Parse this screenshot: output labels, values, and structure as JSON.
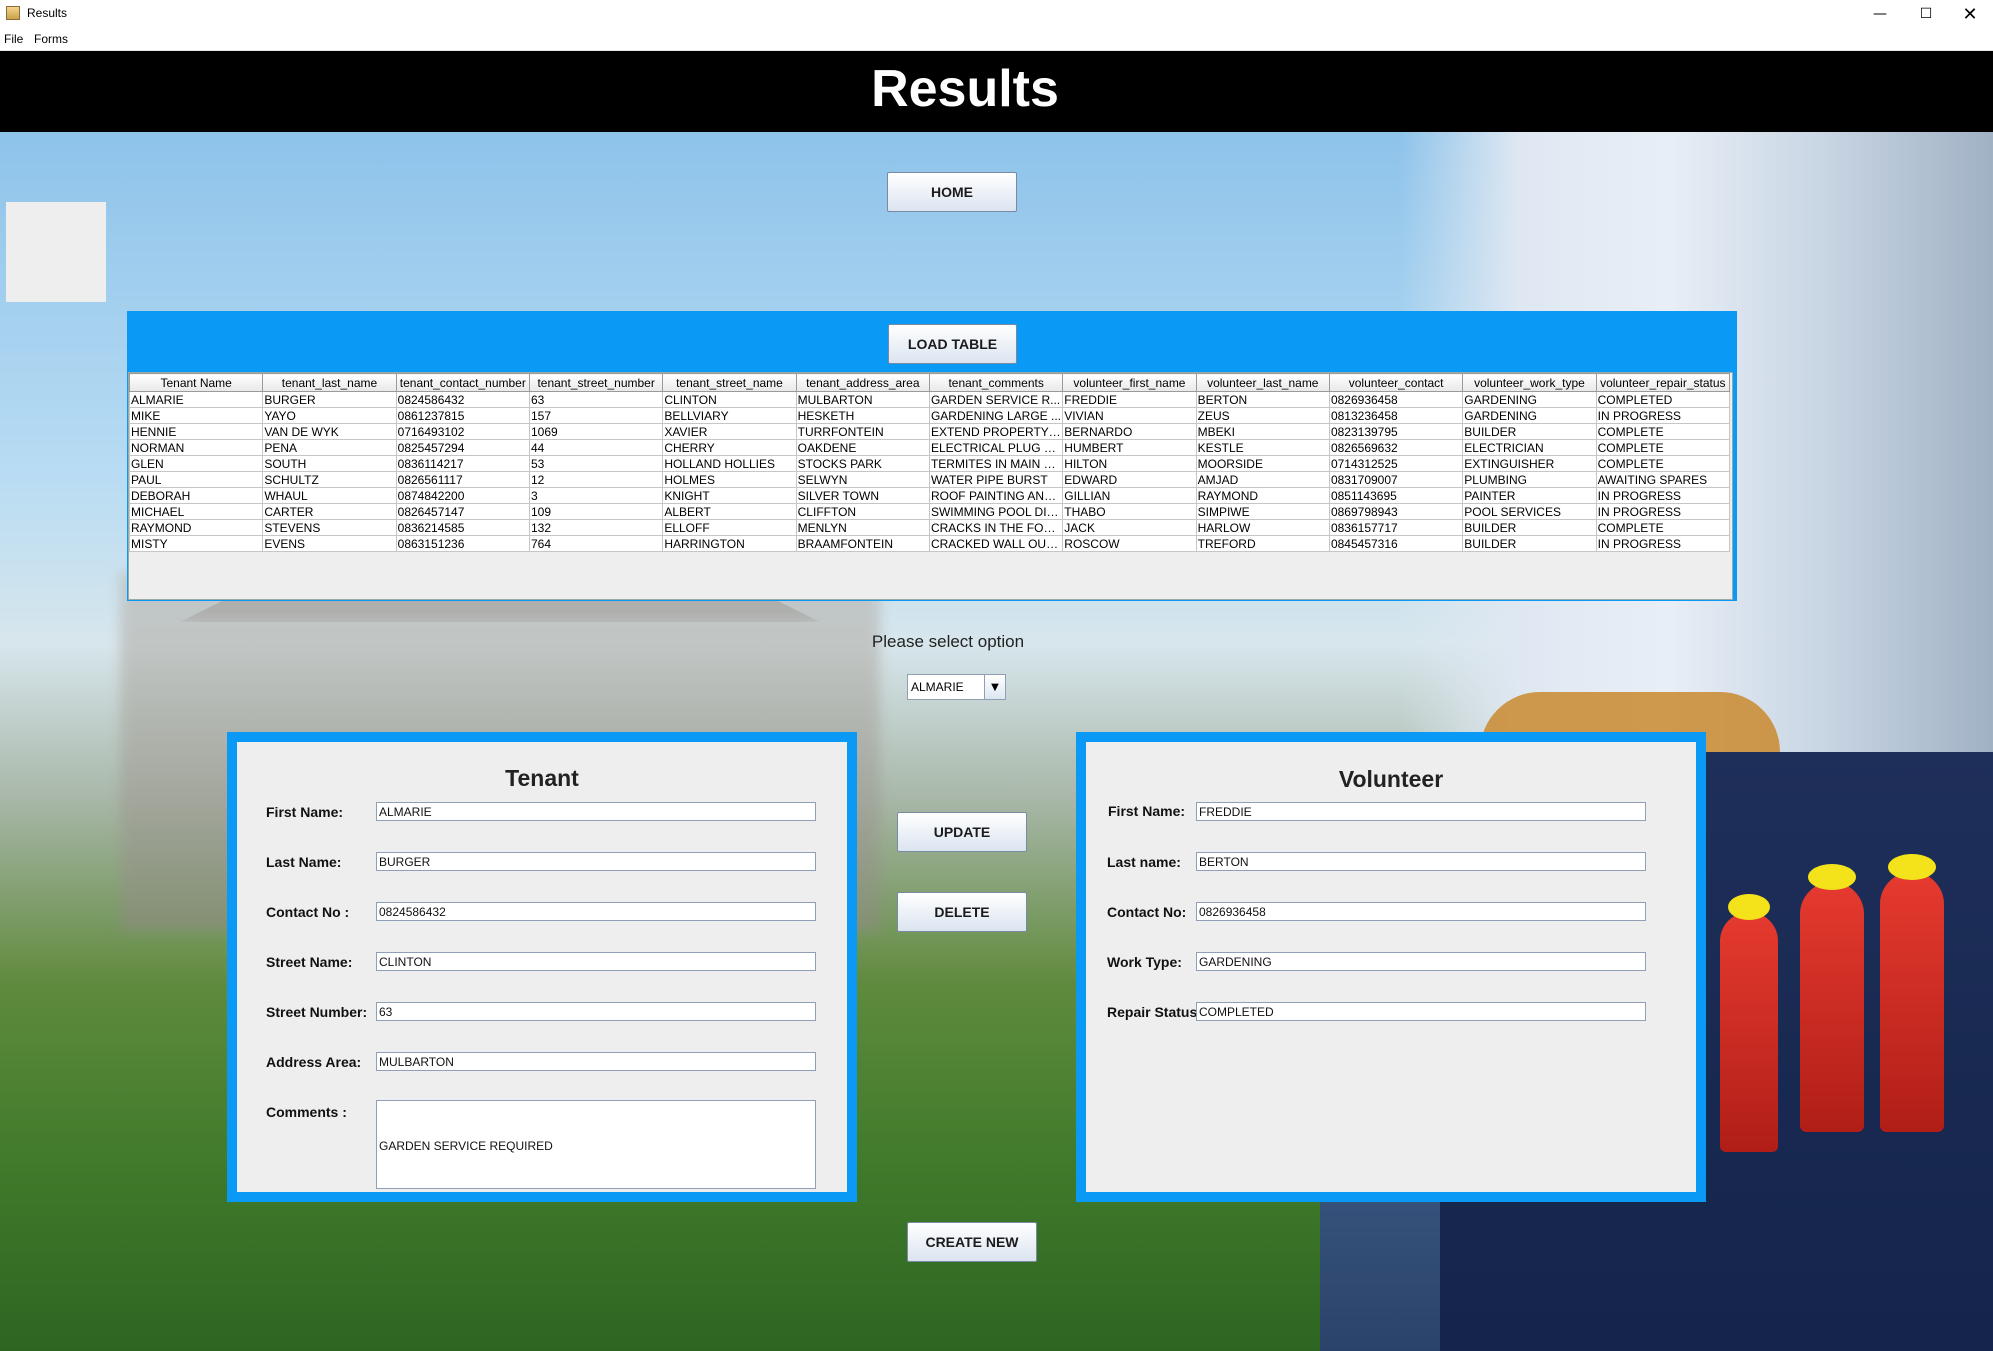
{
  "window": {
    "title": "Results",
    "minimize_icon": "minimize-icon",
    "maximize_icon": "maximize-icon",
    "close_icon": "close-icon"
  },
  "menu": {
    "file": "File",
    "forms": "Forms"
  },
  "header": {
    "title": "Results"
  },
  "buttons": {
    "home": "HOME",
    "load_table": "LOAD TABLE",
    "update": "UPDATE",
    "delete": "DELETE",
    "create_new": "CREATE NEW"
  },
  "table": {
    "columns": [
      "Tenant Name",
      "tenant_last_name",
      "tenant_contact_number",
      "tenant_street_number",
      "tenant_street_name",
      "tenant_address_area",
      "tenant_comments",
      "volunteer_first_name",
      "volunteer_last_name",
      "volunteer_contact",
      "volunteer_work_type",
      "volunteer_repair_status"
    ],
    "rows": [
      [
        "ALMARIE",
        "BURGER",
        "0824586432",
        "63",
        "CLINTON",
        "MULBARTON",
        "GARDEN SERVICE R...",
        "FREDDIE",
        "BERTON",
        "0826936458",
        "GARDENING",
        "COMPLETED"
      ],
      [
        "MIKE",
        "YAYO",
        "0861237815",
        "157",
        "BELLVIARY",
        "HESKETH",
        "GARDENING LARGE ...",
        "VIVIAN",
        "ZEUS",
        "0813236458",
        "GARDENING",
        "IN PROGRESS"
      ],
      [
        "HENNIE",
        "VAN DE WYK",
        "0716493102",
        "1069",
        "XAVIER",
        "TURRFONTEIN",
        "EXTEND PROPERTY ...",
        "BERNARDO",
        "MBEKI",
        "0823139795",
        "BUILDER",
        "COMPLETE"
      ],
      [
        "NORMAN",
        "PENA",
        "0825457294",
        "44",
        "CHERRY",
        "OAKDENE",
        "ELECTRICAL PLUG M...",
        "HUMBERT",
        "KESTLE",
        "0826569632",
        "ELECTRICIAN",
        "COMPLETE"
      ],
      [
        "GLEN",
        "SOUTH",
        "0836114217",
        "53",
        "HOLLAND HOLLIES",
        "STOCKS PARK",
        "TERMITES IN MAIN R...",
        "HILTON",
        "MOORSIDE",
        "0714312525",
        "EXTINGUISHER",
        "COMPLETE"
      ],
      [
        "PAUL",
        "SCHULTZ",
        "0826561117",
        "12",
        "HOLMES",
        "SELWYN",
        "WATER PIPE BURST",
        "EDWARD",
        "AMJAD",
        "0831709007",
        "PLUMBING",
        "AWAITING SPARES"
      ],
      [
        "DEBORAH",
        "WHAUL",
        "0874842200",
        "3",
        "KNIGHT",
        "SILVER TOWN",
        "ROOF PAINTING AND...",
        "GILLIAN",
        "RAYMOND",
        "0851143695",
        "PAINTER",
        "IN PROGRESS"
      ],
      [
        "MICHAEL",
        "CARTER",
        "0826457147",
        "109",
        "ALBERT",
        "CLIFFTON",
        "SWIMMING POOL DIR...",
        "THABO",
        "SIMPIWE",
        "0869798943",
        "POOL SERVICES",
        "IN PROGRESS"
      ],
      [
        "RAYMOND",
        "STEVENS",
        "0836214585",
        "132",
        "ELLOFF",
        "MENLYN",
        "CRACKS IN THE FOU...",
        "JACK",
        "HARLOW",
        "0836157717",
        "BUILDER",
        "COMPLETE"
      ],
      [
        "MISTY",
        "EVENS",
        "0863151236",
        "764",
        "HARRINGTON",
        "BRAAMFONTEIN",
        "CRACKED WALL OUT...",
        "ROSCOW",
        "TREFORD",
        "0845457316",
        "BUILDER",
        "IN PROGRESS"
      ]
    ]
  },
  "selector": {
    "label": "Please select option",
    "value": "ALMARIE"
  },
  "tenant": {
    "heading": "Tenant",
    "labels": {
      "first_name": "First Name:",
      "last_name": "Last Name:",
      "contact": "Contact No :",
      "street_name": "Street Name:",
      "street_number": "Street Number:",
      "address_area": "Address Area:",
      "comments": "Comments :"
    },
    "values": {
      "first_name": "ALMARIE",
      "last_name": "BURGER",
      "contact": "0824586432",
      "street_name": "CLINTON",
      "street_number": "63",
      "address_area": "MULBARTON",
      "comments": "GARDEN SERVICE REQUIRED"
    }
  },
  "volunteer": {
    "heading": "Volunteer",
    "labels": {
      "first_name": "First Name:",
      "last_name": "Last name:",
      "contact": "Contact No:",
      "work_type": "Work Type:",
      "repair_status": "Repair Status:"
    },
    "values": {
      "first_name": "FREDDIE",
      "last_name": "BERTON",
      "contact": "0826936458",
      "work_type": "GARDENING",
      "repair_status": "COMPLETED"
    }
  },
  "colors": {
    "accent_blue": "#0a9af5",
    "header_black": "#000000",
    "panel_gray": "#eeeeee"
  }
}
